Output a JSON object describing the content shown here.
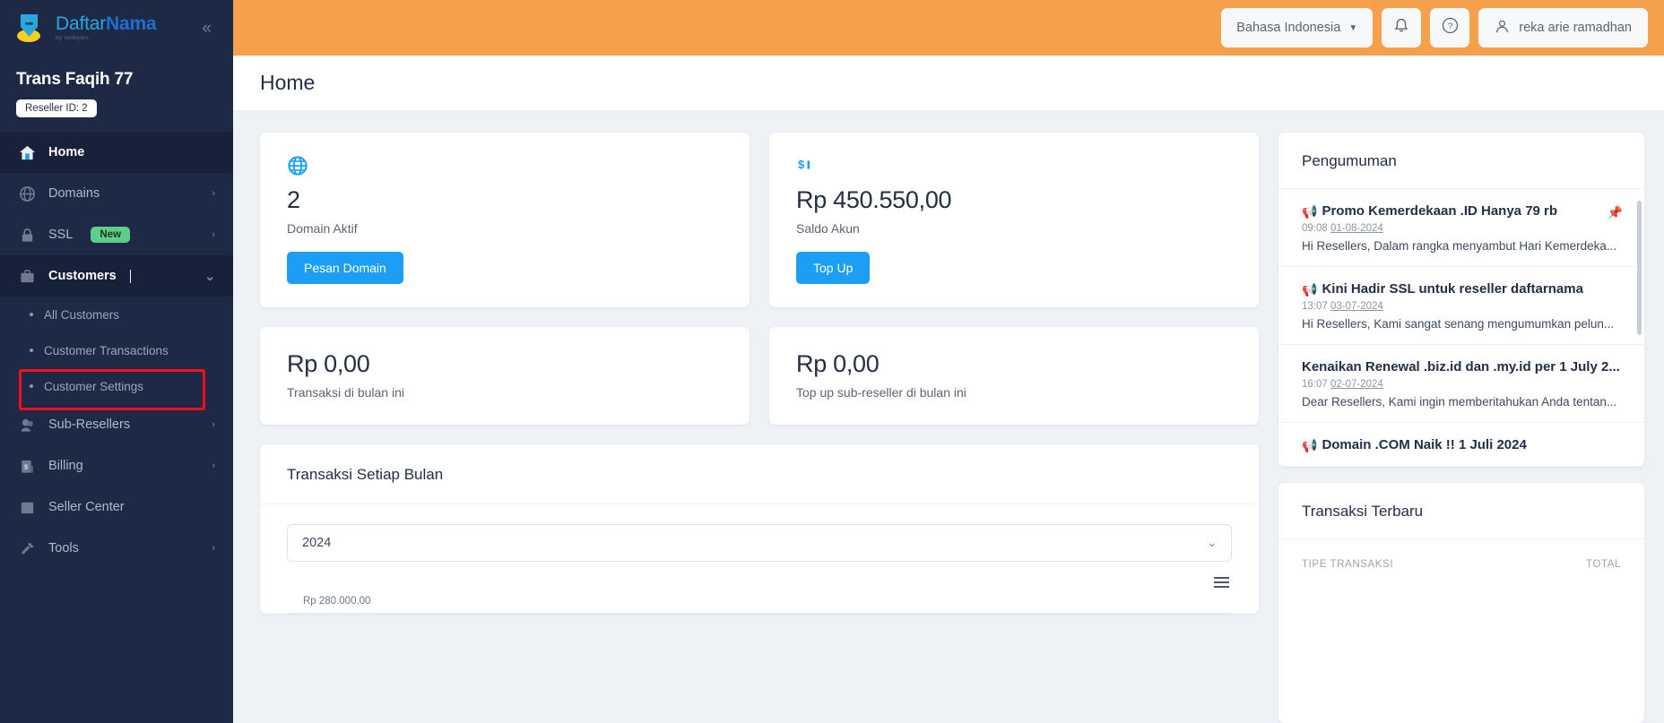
{
  "sidebar": {
    "logo": {
      "text_1": "Daftar",
      "text_2": "Nama",
      "sub": "by redbytes",
      "collapse_icon": "chevron-double-left-icon"
    },
    "brand_name": "Trans Faqih 77",
    "reseller_badge": "Reseller ID: 2",
    "items": [
      {
        "label": "Home",
        "icon": "home-icon",
        "active": true,
        "chevron": ""
      },
      {
        "label": "Domains",
        "icon": "globe-icon",
        "active": false,
        "chevron": "›"
      },
      {
        "label": "SSL",
        "icon": "lock-icon",
        "active": false,
        "chevron": "›",
        "badge": "New"
      },
      {
        "label": "Customers",
        "icon": "briefcase-icon",
        "active": true,
        "chevron": "⌄"
      },
      {
        "label": "Sub-Resellers",
        "icon": "users-icon",
        "active": false,
        "chevron": "›"
      },
      {
        "label": "Billing",
        "icon": "billing-icon",
        "active": false,
        "chevron": "›"
      },
      {
        "label": "Seller Center",
        "icon": "store-icon",
        "active": false,
        "chevron": ""
      },
      {
        "label": "Tools",
        "icon": "tools-icon",
        "active": false,
        "chevron": "›"
      }
    ],
    "sub_items": [
      {
        "label": "All Customers",
        "highlighted": false
      },
      {
        "label": "Customer Transactions",
        "highlighted": false
      },
      {
        "label": "Customer Settings",
        "highlighted": true
      }
    ],
    "highlight_color": "#fc0d1b"
  },
  "topbar": {
    "language": "Bahasa Indonesia",
    "language_chevron": "▼",
    "notification_icon": "bell-icon",
    "help_icon": "question-circle-icon",
    "user_icon": "user-icon",
    "user_name": "reka arie ramadhan",
    "background_color": "#F5A04A"
  },
  "page": {
    "title": "Home"
  },
  "stats": [
    {
      "icon": "globe-icon",
      "value": "2",
      "label": "Domain Aktif",
      "button": "Pesan Domain",
      "button_color": "#1b9ef3"
    },
    {
      "icon": "money-icon",
      "value": "Rp 450.550,00",
      "label": "Saldo Akun",
      "button": "Top Up",
      "button_color": "#1b9ef3"
    },
    {
      "value": "Rp 0,00",
      "label": "Transaksi di bulan ini"
    },
    {
      "value": "Rp 0,00",
      "label": "Top up sub-reseller di bulan ini"
    }
  ],
  "chart_panel": {
    "title": "Transaksi Setiap Bulan",
    "year_selected": "2024",
    "year_chevron": "⌄",
    "menu_icon": "hamburger-menu-icon",
    "axis_top_label": "Rp 280.000,00"
  },
  "chart_data": {
    "type": "line",
    "title": "Transaksi Setiap Bulan",
    "x": [
      "2024"
    ],
    "categories": [],
    "values": [],
    "ylabel": "",
    "xlabel": "",
    "ylim": [
      0,
      280000
    ],
    "ytick_labels": [
      "Rp 280.000,00"
    ],
    "legend": [],
    "grid": true
  },
  "announcements": {
    "title": "Pengumuman",
    "items": [
      {
        "icon": "megaphone-icon",
        "title": "Promo Kemerdekaan .ID Hanya 79 rb",
        "time": "09:08",
        "date": "01-08-2024",
        "desc": "Hi Resellers, Dalam rangka menyambut Hari Kemerdeka...",
        "pinned": true,
        "pin_icon": "pin-icon"
      },
      {
        "icon": "megaphone-icon",
        "title": "Kini Hadir SSL untuk reseller daftarnama",
        "time": "13:07",
        "date": "03-07-2024",
        "desc": "Hi Resellers, Kami sangat senang mengumumkan pelun...",
        "pinned": false
      },
      {
        "icon": "",
        "title": "Kenaikan Renewal .biz.id dan .my.id per 1 July 2...",
        "time": "16:07",
        "date": "02-07-2024",
        "desc": "Dear Resellers, Kami ingin memberitahukan Anda tentan...",
        "pinned": false
      },
      {
        "icon": "megaphone-icon",
        "title": "Domain .COM Naik !! 1 Juli 2024",
        "time": "",
        "date": "",
        "desc": "",
        "pinned": false
      }
    ]
  },
  "recent_transactions": {
    "title": "Transaksi Terbaru",
    "columns": [
      "TIPE TRANSAKSI",
      "TOTAL"
    ],
    "rows": []
  }
}
